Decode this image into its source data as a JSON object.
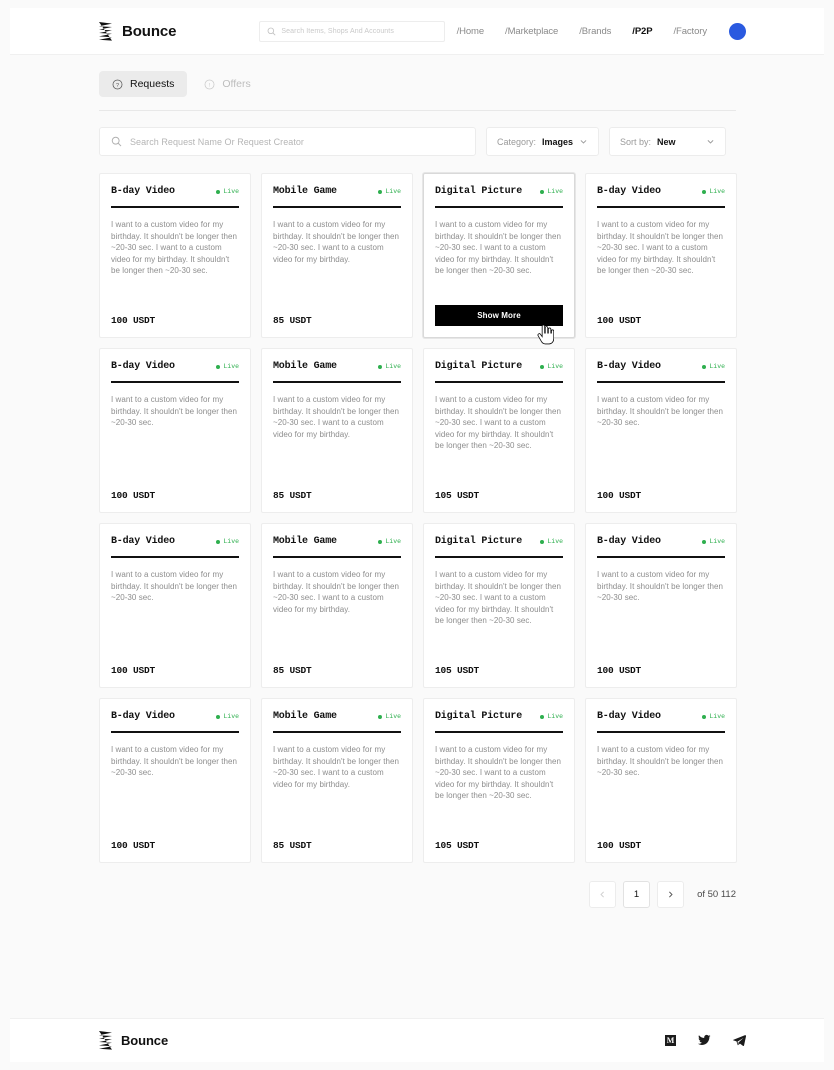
{
  "header": {
    "brand": "Bounce",
    "logo_icon": "bounce-zigzag-logo",
    "search": {
      "placeholder": "Search Items, Shops And Accounts",
      "value": "",
      "icon": "search-icon"
    },
    "nav": [
      {
        "label": "/Home",
        "active": false
      },
      {
        "label": "/Marketplace",
        "active": false
      },
      {
        "label": "/Brands",
        "active": false
      },
      {
        "label": "/P2P",
        "active": true
      },
      {
        "label": "/Factory",
        "active": false
      }
    ],
    "avatar_color": "#2a5ae0"
  },
  "tabs": [
    {
      "label": "Requests",
      "icon": "question-circle-icon",
      "active": true
    },
    {
      "label": "Offers",
      "icon": "exclamation-circle-icon",
      "active": false
    }
  ],
  "filters": {
    "search": {
      "placeholder": "Search Request Name Or Request Creator",
      "value": "",
      "icon": "search-icon"
    },
    "category": {
      "label": "Category:",
      "value": "Images",
      "icon": "chevron-down-icon"
    },
    "sort": {
      "label": "Sort by:",
      "value": "New",
      "icon": "chevron-down-icon"
    }
  },
  "cards": [
    {
      "title": "B-day Video",
      "status": "Live",
      "desc": "I want to a custom video for my birthday. It shouldn't be longer then ~20-30 sec. I want to a custom video for my birthday. It shouldn't be longer then ~20-30 sec.",
      "price": "100 USDT",
      "hovered": false
    },
    {
      "title": "Mobile Game",
      "status": "Live",
      "desc": "I want to a custom video for my birthday. It shouldn't be longer then ~20-30 sec. I want to a custom video for my birthday.",
      "price": "85 USDT",
      "hovered": false
    },
    {
      "title": "Digital Picture",
      "status": "Live",
      "desc": "I want to a custom video for my birthday. It shouldn't be longer then ~20-30 sec. I want to a custom video for my birthday. It shouldn't be longer then ~20-30 sec.",
      "price": "",
      "hovered": true,
      "button_label": "Show More"
    },
    {
      "title": "B-day Video",
      "status": "Live",
      "desc": "I want to a custom video for my birthday. It shouldn't be longer then ~20-30 sec. I want to a custom video for my birthday. It shouldn't be longer then ~20-30 sec.",
      "price": "100 USDT",
      "hovered": false
    },
    {
      "title": "B-day Video",
      "status": "Live",
      "desc": "I want to a custom video for my birthday. It shouldn't be longer then ~20-30 sec.",
      "price": "100 USDT",
      "hovered": false
    },
    {
      "title": "Mobile Game",
      "status": "Live",
      "desc": "I want to a custom video for my birthday. It shouldn't be longer then ~20-30 sec. I want to a custom video for my birthday.",
      "price": "85 USDT",
      "hovered": false
    },
    {
      "title": "Digital Picture",
      "status": "Live",
      "desc": "I want to a custom video for my birthday. It shouldn't be longer then ~20-30 sec. I want to a custom video for my birthday. It shouldn't be longer then ~20-30 sec.",
      "price": "105 USDT",
      "hovered": false
    },
    {
      "title": "B-day Video",
      "status": "Live",
      "desc": "I want to a custom video for my birthday. It shouldn't be longer then ~20-30 sec.",
      "price": "100 USDT",
      "hovered": false
    },
    {
      "title": "B-day Video",
      "status": "Live",
      "desc": "I want to a custom video for my birthday. It shouldn't be longer then ~20-30 sec.",
      "price": "100 USDT",
      "hovered": false
    },
    {
      "title": "Mobile Game",
      "status": "Live",
      "desc": "I want to a custom video for my birthday. It shouldn't be longer then ~20-30 sec. I want to a custom video for my birthday.",
      "price": "85 USDT",
      "hovered": false
    },
    {
      "title": "Digital Picture",
      "status": "Live",
      "desc": "I want to a custom video for my birthday. It shouldn't be longer then ~20-30 sec. I want to a custom video for my birthday. It shouldn't be longer then ~20-30 sec.",
      "price": "105 USDT",
      "hovered": false
    },
    {
      "title": "B-day Video",
      "status": "Live",
      "desc": "I want to a custom video for my birthday. It shouldn't be longer then ~20-30 sec.",
      "price": "100 USDT",
      "hovered": false
    },
    {
      "title": "B-day Video",
      "status": "Live",
      "desc": "I want to a custom video for my birthday. It shouldn't be longer then ~20-30 sec.",
      "price": "100 USDT",
      "hovered": false
    },
    {
      "title": "Mobile Game",
      "status": "Live",
      "desc": "I want to a custom video for my birthday. It shouldn't be longer then ~20-30 sec. I want to a custom video for my birthday.",
      "price": "85 USDT",
      "hovered": false
    },
    {
      "title": "Digital Picture",
      "status": "Live",
      "desc": "I want to a custom video for my birthday. It shouldn't be longer then ~20-30 sec. I want to a custom video for my birthday. It shouldn't be longer then ~20-30 sec.",
      "price": "105 USDT",
      "hovered": false
    },
    {
      "title": "B-day Video",
      "status": "Live",
      "desc": "I want to a custom video for my birthday. It shouldn't be longer then ~20-30 sec.",
      "price": "100 USDT",
      "hovered": false
    }
  ],
  "pagination": {
    "prev_icon": "chevron-left-icon",
    "next_icon": "chevron-right-icon",
    "current_page": "1",
    "total_label": "of 50 112"
  },
  "footer": {
    "brand": "Bounce",
    "logo_icon": "bounce-zigzag-logo",
    "socials": [
      {
        "name": "medium-icon",
        "label": "M"
      },
      {
        "name": "twitter-icon",
        "label": ""
      },
      {
        "name": "telegram-icon",
        "label": ""
      }
    ]
  },
  "colors": {
    "accent": "#2a5ae0",
    "status_live": "#2eaf4e",
    "button": "#000000",
    "page_bg": "#fafafa"
  }
}
